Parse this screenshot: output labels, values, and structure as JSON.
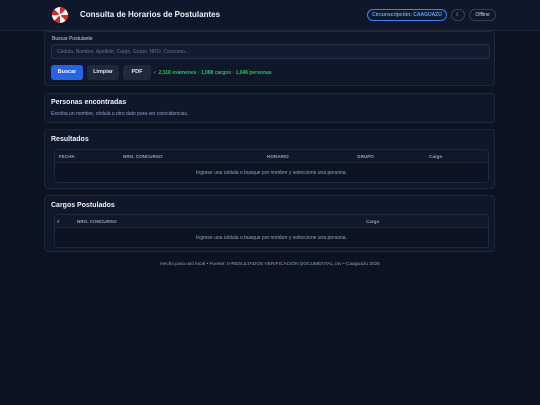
{
  "header": {
    "title": "Consulta de Horarios de Postulantes",
    "circunscripcion": "Circunscripción: CAAGUAZÚ",
    "theme_icon": "moon-icon",
    "status": "Offline"
  },
  "search": {
    "label": "Buscar Postulante",
    "placeholder": "Cédula, Nombre, Apellido, Cargo, Grupo, NRO. Concurso...",
    "value": "",
    "buttons": {
      "buscar": "Buscar",
      "limpiar": "Limpiar",
      "pdf": "PDF"
    },
    "stats": "✓ 2,118 exámenes · 1,088 cargos · 1,046 personas"
  },
  "personas": {
    "title": "Personas encontradas",
    "subtitle": "Escriba un nombre, cédula u otro dato para ver coincidencias."
  },
  "resultados": {
    "title": "Resultados",
    "columns": [
      "FECHA",
      "NRO. CONCURSO",
      "HORARIO",
      "GRUPO",
      "Cargo"
    ],
    "empty": "Ingrese una cédula o busque por nombre y seleccione una persona."
  },
  "cargos": {
    "title": "Cargos Postulados",
    "columns": [
      "#",
      "NRO. CONCURSO",
      "Cargo"
    ],
    "empty": "Ingrese una cédula o busque por nombre y seleccione una persona."
  },
  "footer": "Hecho para uso local • Fuente: 0-RESULTADOS VERIFICACIÓN DOCUMENTAL.csv • Caaguazú 2026",
  "colors": {
    "accent": "#2563eb",
    "success": "#22c55e",
    "background": "#0b1220"
  }
}
